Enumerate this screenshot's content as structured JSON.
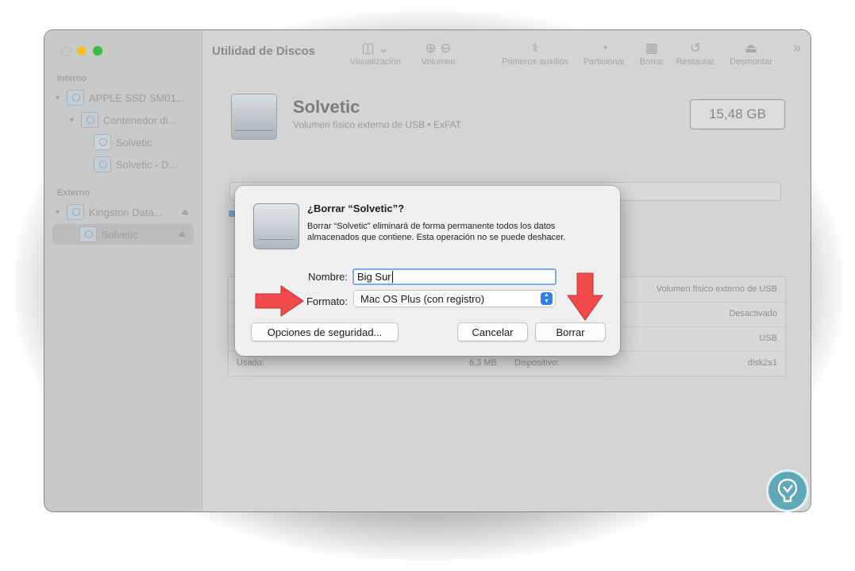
{
  "window": {
    "title": "Utilidad de Discos"
  },
  "sidebar": {
    "sections": [
      {
        "title": "Interno",
        "items": [
          {
            "label": "APPLE SSD SM01...",
            "level": 0,
            "expanded": true
          },
          {
            "label": "Contenedor di...",
            "level": 1,
            "expanded": true
          },
          {
            "label": "Solvetic",
            "level": 2
          },
          {
            "label": "Solvetic - D...",
            "level": 2
          }
        ]
      },
      {
        "title": "Externo",
        "items": [
          {
            "label": "Kingston Data...",
            "level": 0,
            "expanded": true,
            "eject": true
          },
          {
            "label": "Solvetic",
            "level": 1,
            "eject": true,
            "selected": true
          }
        ]
      }
    ]
  },
  "toolbar": {
    "items": [
      {
        "label": "Visualización",
        "icon": "sidebar-view-icon"
      },
      {
        "label": "Volumen",
        "icon": "plus-minus-icon"
      },
      {
        "label": "Primeros auxilios",
        "icon": "stethoscope-icon"
      },
      {
        "label": "Particionar",
        "icon": "pie-chart-icon"
      },
      {
        "label": "Borrar",
        "icon": "eraser-icon"
      },
      {
        "label": "Restaurar",
        "icon": "restore-icon"
      },
      {
        "label": "Desmontar",
        "icon": "eject-icon"
      }
    ]
  },
  "volume": {
    "name": "Solvetic",
    "subtitle": "Volumen físico externo de USB • ExFAT",
    "capacity": "15,48 GB"
  },
  "info": {
    "type_value": "Volumen físico externo de USB",
    "owners_value": "Desactivado",
    "connection_value": "USB",
    "used_label": "Usado:",
    "used_value": "6,3 MB",
    "device_label": "Dispositivo:",
    "device_value": "disk2s1"
  },
  "dialog": {
    "title": "¿Borrar “Solvetic”?",
    "message": "Borrar “Solvetic” eliminará de forma permanente todos los datos almacenados que contiene. Esta operación no se puede deshacer.",
    "name_label": "Nombre:",
    "name_value": "Big Sur",
    "format_label": "Formato:",
    "format_value": "Mac OS Plus (con registro)",
    "security_button": "Opciones de seguridad...",
    "cancel_button": "Cancelar",
    "erase_button": "Borrar"
  },
  "colors": {
    "accent": "#2f7ff1",
    "arrow": "#f04a4a"
  }
}
